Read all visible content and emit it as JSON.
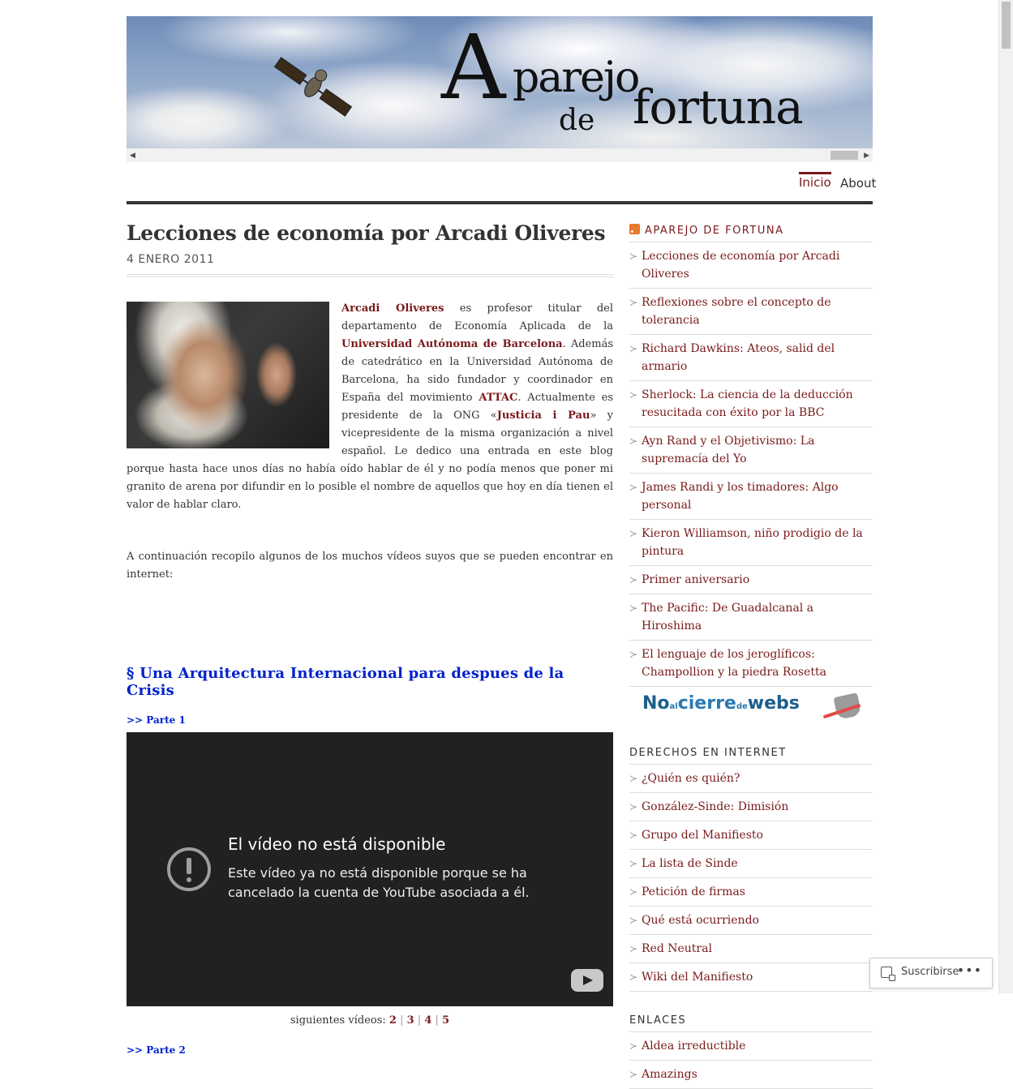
{
  "site": {
    "logo_big": "A",
    "logo_rest1": "parejo",
    "logo_de": "de",
    "logo_rest2": "fortuna"
  },
  "nav": {
    "items": [
      "Inicio",
      "About"
    ],
    "active": "Inicio"
  },
  "post": {
    "title": "Lecciones de economía por Arcadi Oliveres",
    "date": "4 ENERO 2011",
    "p1_link1": "Arcadi Oliveres",
    "p1_t1": " es profesor titular del departamento de Economía Aplicada de la ",
    "p1_link2": "Universidad Autónoma de Barcelona",
    "p1_t2": ". Además de catedrático en la Universidad Autónoma de Barcelona, ha sido fundador y coordinador en España del movimiento ",
    "p1_link3": "ATTAC",
    "p1_t3": ". Actualmente es presidente de la ONG «",
    "p1_link4": "Justicia i Pau",
    "p1_t4": "» y vicepresidente de la misma organización a nivel español. Le dedico una entrada en este blog porque hasta hace unos días no había oído hablar de él y no podía menos que poner mi granito de arena por difundir en lo posible el nombre de aquellos que hoy en día tienen el valor de hablar claro.",
    "p2": "A continuación recopilo algunos de los muchos vídeos suyos que se pueden encontrar en internet:",
    "section_title": "§ Una Arquitectura Internacional para despues de la Crisis",
    "parte1": ">> Parte 1",
    "video": {
      "title": "El vídeo no está disponible",
      "desc": "Este vídeo ya no está disponible porque se ha cancelado la cuenta de YouTube asociada a él."
    },
    "next_label": "siguientes vídeos: ",
    "next_links": [
      "2",
      "3",
      "4",
      "5"
    ],
    "parte2": ">> Parte 2"
  },
  "sidebar": {
    "feed_title": "APAREJO DE FORTUNA",
    "feed_items": [
      "Lecciones de economía por Arcadi Oliveres",
      "Reflexiones sobre el concepto de tolerancia",
      "Richard Dawkins: Ateos, salid del armario",
      "Sherlock: La ciencia de la deducción resucitada con éxito por la BBC",
      "Ayn Rand y el Objetivismo: La supremacía del Yo",
      "James Randi y los timadores: Algo personal",
      "Kieron Williamson, niño prodigio de la pintura",
      "Primer aniversario",
      "The Pacific: De Guadalcanal a Hiroshima",
      "El lenguaje de los jeroglíficos: Champollion y la piedra Rosetta"
    ],
    "badge": {
      "no": "No",
      "al": "al",
      "cierre": "cierre",
      "de": "de",
      "webs": "webs"
    },
    "derechos_title": "DERECHOS EN INTERNET",
    "derechos_items": [
      "¿Quién es quién?",
      "González-Sinde: Dimisión",
      "Grupo del Manifiesto",
      "La lista de Sinde",
      "Petición de firmas",
      "Qué está ocurriendo",
      "Red Neutral",
      "Wiki del Manifiesto"
    ],
    "enlaces_title": "ENLACES",
    "enlaces_items": [
      "Aldea irreductible",
      "Amazings"
    ]
  },
  "follow": {
    "label": "Suscribirse",
    "more": "•••"
  },
  "colors": {
    "accent": "#7a1a1a",
    "link_blue": "#0022cc",
    "video_bg": "#212121"
  }
}
